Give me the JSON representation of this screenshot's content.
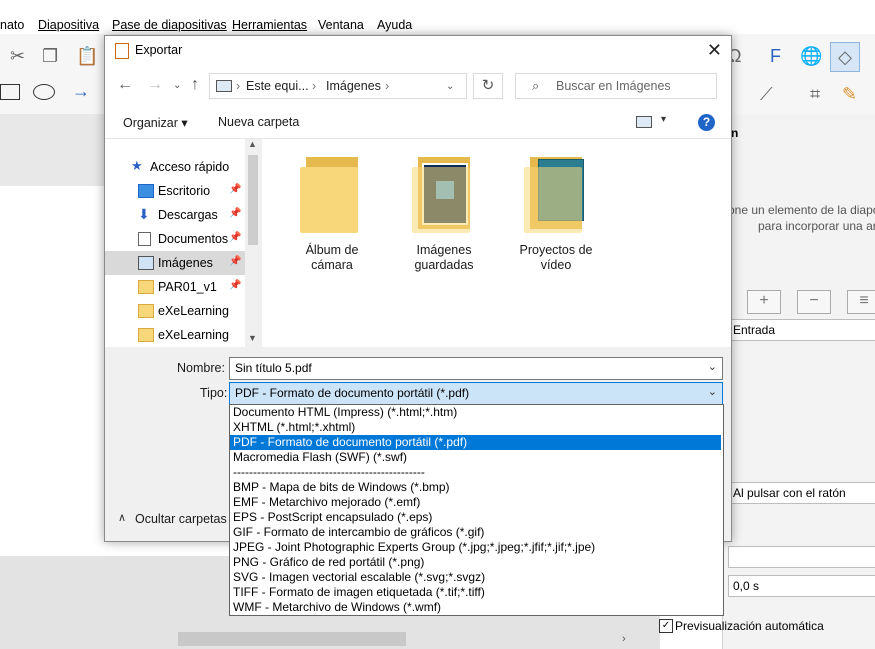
{
  "app": {
    "menu": [
      "nato",
      "Diapositiva",
      "Pase de diapositivas",
      "Herramientas",
      "Ventana",
      "Ayuda"
    ],
    "right_panel": {
      "heading_fragment": "n",
      "hint_line1": "one un elemento de la diapos",
      "hint_line2": "para incorporar una ar",
      "add_button": "+",
      "remove_button": "−",
      "entrada": "Entrada",
      "trigger": "Al pulsar con el ratón",
      "duration": "0,0 s",
      "autopreview_label": "Previsualización automática",
      "autopreview_checked": true
    }
  },
  "dialog": {
    "title": "Exportar",
    "address": [
      "Este equi...",
      "Imágenes"
    ],
    "search_placeholder": "Buscar en Imágenes",
    "commands": {
      "organize": "Organizar ▾",
      "new_folder": "Nueva carpeta"
    },
    "nav_items": [
      {
        "label": "Acceso rápido",
        "icon": "star-icon",
        "pinned": false,
        "selected": false
      },
      {
        "label": "Escritorio",
        "icon": "desktop-icon",
        "pinned": true,
        "selected": false
      },
      {
        "label": "Descargas",
        "icon": "download-icon",
        "pinned": true,
        "selected": false
      },
      {
        "label": "Documentos",
        "icon": "document-icon",
        "pinned": true,
        "selected": false
      },
      {
        "label": "Imágenes",
        "icon": "pictures-icon",
        "pinned": true,
        "selected": true
      },
      {
        "label": "PAR01_v1",
        "icon": "folder-icon",
        "pinned": true,
        "selected": false
      },
      {
        "label": "eXeLearning",
        "icon": "folder-icon",
        "pinned": false,
        "selected": false
      },
      {
        "label": "eXeLearning",
        "icon": "folder-icon",
        "pinned": false,
        "selected": false
      }
    ],
    "folders": [
      {
        "line1": "Álbum de",
        "line2": "cámara"
      },
      {
        "line1": "Imágenes",
        "line2": "guardadas"
      },
      {
        "line1": "Proyectos de",
        "line2": "vídeo"
      }
    ],
    "name_label": "Nombre:",
    "name_value": "Sin título 5.pdf",
    "type_label": "Tipo:",
    "type_value": "PDF - Formato de documento portátil (*.pdf)",
    "hide_folders": "Ocultar carpetas",
    "type_options": [
      "Documento HTML (Impress) (*.html;*.htm)",
      "XHTML (*.html;*.xhtml)",
      "PDF - Formato de documento portátil (*.pdf)",
      "Macromedia Flash (SWF) (*.swf)",
      "------------------------------------------------",
      "BMP - Mapa de bits de Windows (*.bmp)",
      "EMF - Metarchivo mejorado (*.emf)",
      "EPS - PostScript encapsulado (*.eps)",
      "GIF - Formato de intercambio de gráficos (*.gif)",
      "JPEG - Joint Photographic Experts Group (*.jpg;*.jpeg;*.jfif;*.jif;*.jpe)",
      "PNG - Gráfico de red portátil (*.png)",
      "SVG - Imagen vectorial escalable (*.svg;*.svgz)",
      "TIFF - Formato de imagen etiquetada (*.tif;*.tiff)",
      "WMF - Metarchivo de Windows (*.wmf)"
    ],
    "selected_option_index": 2
  },
  "colors": {
    "accent": "#0078d7",
    "folder": "#f7d77a",
    "help": "#1f65c8"
  }
}
